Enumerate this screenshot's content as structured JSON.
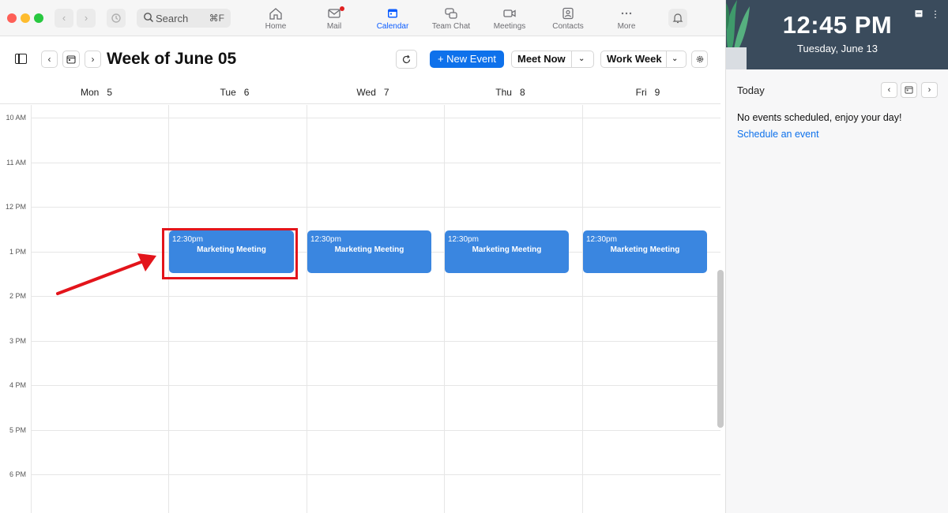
{
  "toolbar": {
    "search_label": "Search",
    "search_shortcut": "⌘F",
    "tabs": [
      {
        "label": "Home",
        "icon": "home-icon"
      },
      {
        "label": "Mail",
        "icon": "mail-icon"
      },
      {
        "label": "Calendar",
        "icon": "calendar-icon",
        "active": true
      },
      {
        "label": "Team Chat",
        "icon": "chat-icon"
      },
      {
        "label": "Meetings",
        "icon": "video-icon"
      },
      {
        "label": "Contacts",
        "icon": "contacts-icon"
      },
      {
        "label": "More",
        "icon": "more-icon"
      }
    ]
  },
  "calendar": {
    "title": "Week of June 05",
    "new_event_label": "+ New Event",
    "meet_now_label": "Meet Now",
    "view_label": "Work Week",
    "days": [
      {
        "name": "Mon",
        "num": "5"
      },
      {
        "name": "Tue",
        "num": "6"
      },
      {
        "name": "Wed",
        "num": "7"
      },
      {
        "name": "Thu",
        "num": "8"
      },
      {
        "name": "Fri",
        "num": "9"
      }
    ],
    "hours": [
      "10 AM",
      "11 AM",
      "12 PM",
      "1 PM",
      "2 PM",
      "3 PM",
      "4 PM",
      "5 PM",
      "6 PM"
    ],
    "events": [
      {
        "day": "Tue",
        "time": "12:30pm",
        "title": "Marketing Meeting"
      },
      {
        "day": "Wed",
        "time": "12:30pm",
        "title": "Marketing Meeting"
      },
      {
        "day": "Thu",
        "time": "12:30pm",
        "title": "Marketing Meeting"
      },
      {
        "day": "Fri",
        "time": "12:30pm",
        "title": "Marketing Meeting"
      }
    ]
  },
  "side_panel": {
    "clock": "12:45 PM",
    "date": "Tuesday, June 13",
    "today_label": "Today",
    "no_events": "No events scheduled, enjoy your day!",
    "schedule_link": "Schedule an event"
  },
  "colors": {
    "accent": "#0e71eb",
    "event": "#3a86e0",
    "highlight": "#e3141b",
    "clock_bg": "#3a4b5c"
  }
}
